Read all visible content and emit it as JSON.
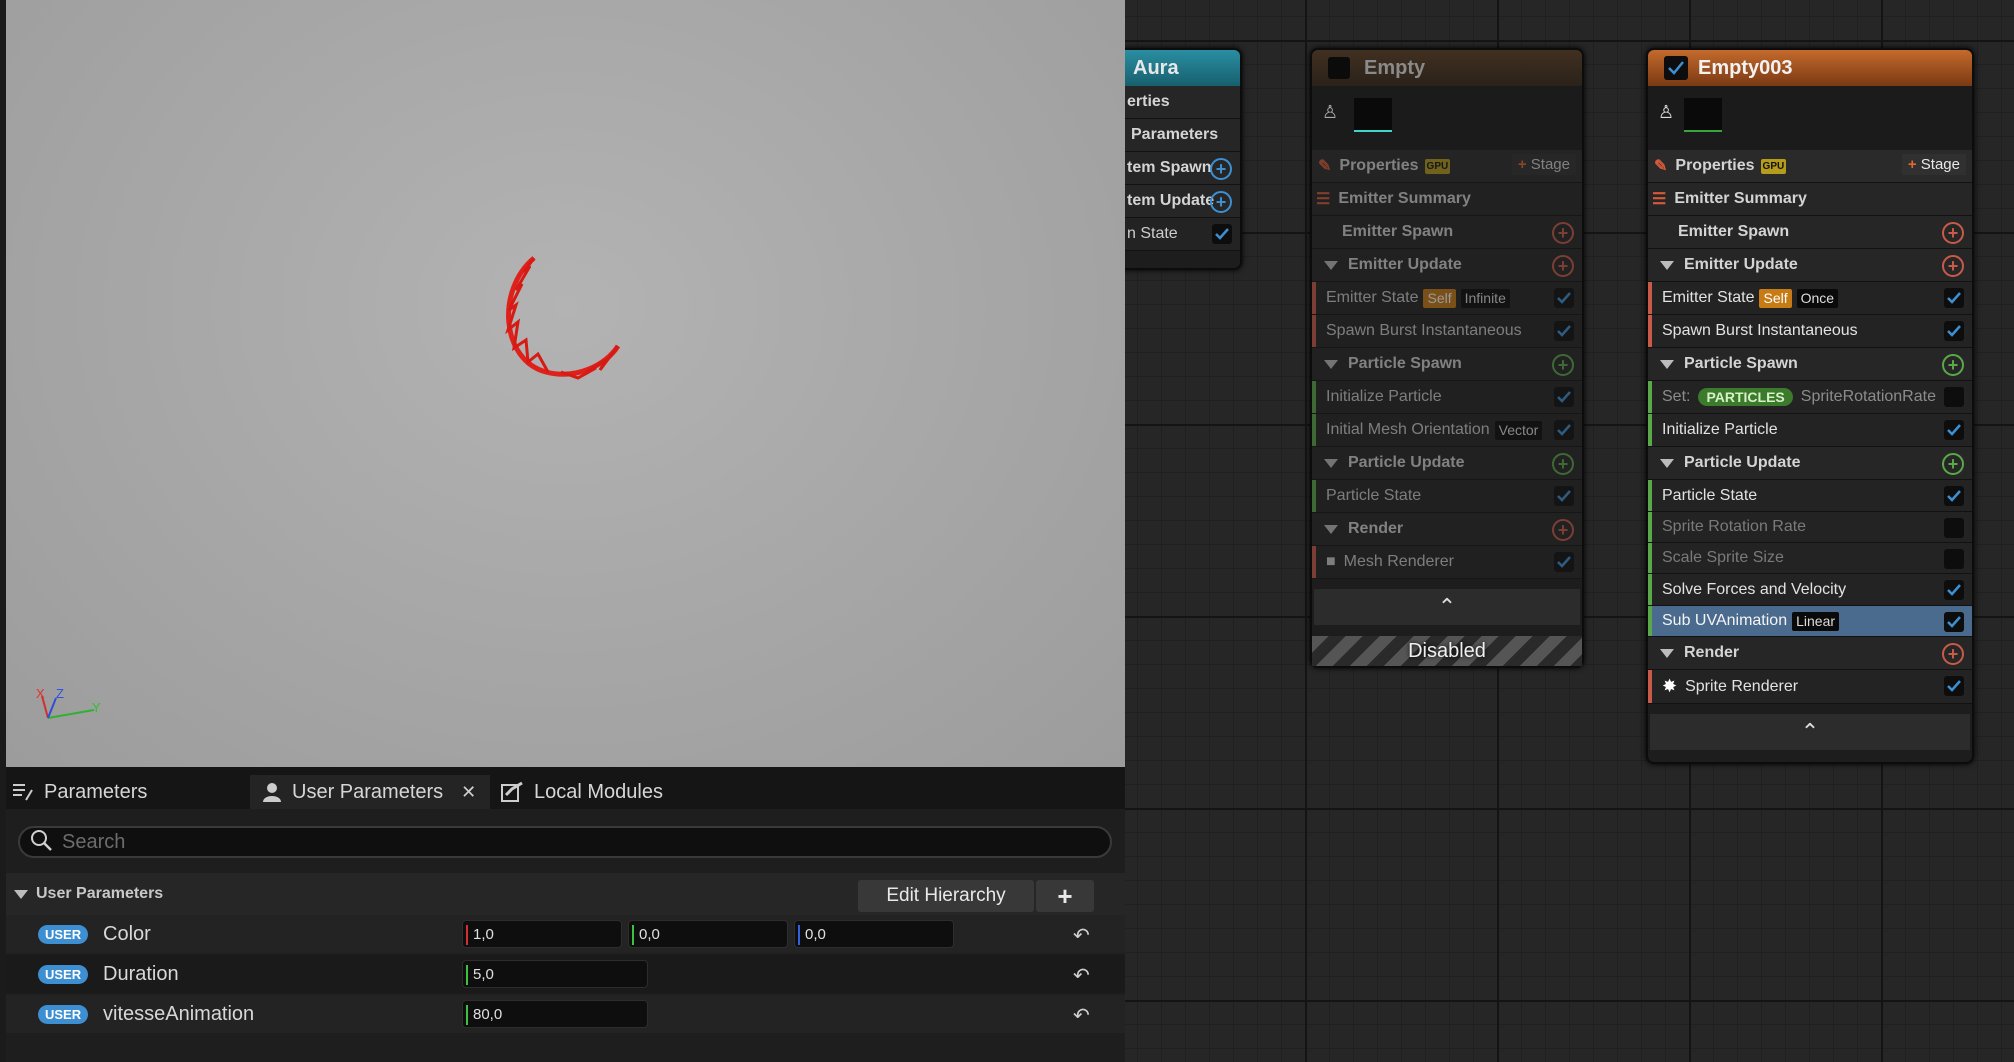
{
  "viewport": {
    "axis_x": "X",
    "axis_y": "Y",
    "axis_z": "Z"
  },
  "tabs": [
    {
      "label": "Parameters"
    },
    {
      "label": "User Parameters"
    },
    {
      "label": "Local Modules"
    }
  ],
  "search": {
    "placeholder": "Search"
  },
  "user_params": {
    "section_label": "User Parameters",
    "edit_hierarchy": "Edit Hierarchy",
    "badge": "USER",
    "rows": [
      {
        "name": "Color",
        "values": [
          "1,0",
          "0,0",
          "0,0"
        ]
      },
      {
        "name": "Duration",
        "values": [
          "5,0"
        ]
      },
      {
        "name": "vitesseAnimation",
        "values": [
          "80,0"
        ]
      }
    ]
  },
  "aura_node": {
    "title": "Aura",
    "rows": [
      "erties",
      "Parameters",
      "tem Spawn",
      "tem Update",
      "n State"
    ]
  },
  "empty_node": {
    "title": "Empty",
    "properties": "Properties",
    "gpu": "GPU",
    "stage": "Stage",
    "summary": "Emitter Summary",
    "emitter_spawn": "Emitter Spawn",
    "emitter_update": "Emitter Update",
    "emitter_state": "Emitter State",
    "self": "Self",
    "infinite": "Infinite",
    "spawn_burst": "Spawn Burst Instantaneous",
    "particle_spawn": "Particle Spawn",
    "init_particle": "Initialize Particle",
    "init_mesh": "Initial Mesh Orientation",
    "vector": "Vector",
    "particle_update": "Particle Update",
    "particle_state": "Particle State",
    "render": "Render",
    "mesh_renderer": "Mesh Renderer",
    "disabled": "Disabled"
  },
  "empty003_node": {
    "title": "Empty003",
    "properties": "Properties",
    "gpu": "GPU",
    "stage": "Stage",
    "summary": "Emitter Summary",
    "emitter_spawn": "Emitter Spawn",
    "emitter_update": "Emitter Update",
    "emitter_state": "Emitter State",
    "self": "Self",
    "once": "Once",
    "spawn_burst": "Spawn Burst Instantaneous",
    "particle_spawn": "Particle Spawn",
    "set": "Set:",
    "particles": "PARTICLES",
    "sprite_rot_rate_set": "SpriteRotationRate",
    "init_particle": "Initialize Particle",
    "particle_update": "Particle Update",
    "particle_state": "Particle State",
    "sprite_rotation_rate": "Sprite Rotation Rate",
    "scale_sprite_size": "Scale Sprite Size",
    "solve_forces": "Solve Forces and Velocity",
    "sub_uv": "Sub UVAnimation",
    "linear": "Linear",
    "render": "Render",
    "sprite_renderer": "Sprite Renderer"
  },
  "colors": {
    "accent_blue": "#3d8fd1",
    "emitter_orange": "#c0621c",
    "aura_teal": "#1f7a8c",
    "particle_green": "#5aa84a",
    "emitter_red": "#c85a4a"
  }
}
